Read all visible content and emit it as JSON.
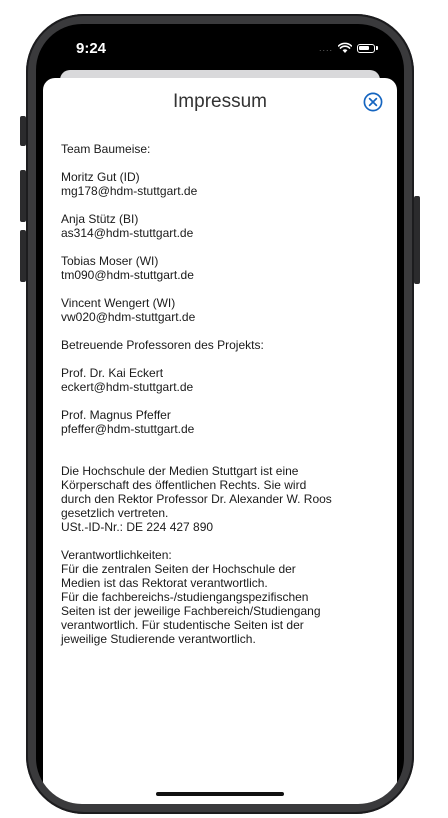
{
  "status_bar": {
    "time": "9:24",
    "signal": "....",
    "wifi_icon": "wifi-icon",
    "battery_icon": "battery-icon"
  },
  "modal": {
    "title": "Impressum",
    "close_icon": "close-circle-icon"
  },
  "content": {
    "team_heading": "Team Baumeise:",
    "members": [
      {
        "name": "Moritz Gut (ID)",
        "email": "mg178@hdm-stuttgart.de"
      },
      {
        "name": "Anja Stütz (BI)",
        "email": "as314@hdm-stuttgart.de"
      },
      {
        "name": "Tobias Moser (WI)",
        "email": "tm090@hdm-stuttgart.de"
      },
      {
        "name": "Vincent Wengert (WI)",
        "email": "vw020@hdm-stuttgart.de"
      }
    ],
    "professors_heading": "Betreuende Professoren des Projekts:",
    "professors": [
      {
        "name": "Prof. Dr. Kai Eckert",
        "email": "eckert@hdm-stuttgart.de"
      },
      {
        "name": "Prof. Magnus Pfeffer",
        "email": "pfeffer@hdm-stuttgart.de"
      }
    ],
    "legal_lines": [
      "Die Hochschule der Medien Stuttgart ist eine",
      "Körperschaft des öffentlichen Rechts. Sie wird",
      "durch den Rektor Professor Dr. Alexander W. Roos",
      "gesetzlich vertreten.",
      "USt.-ID-Nr.: DE 224 427 890"
    ],
    "responsibility_lines": [
      "Verantwortlichkeiten:",
      "Für die zentralen Seiten der Hochschule der",
      "Medien ist das Rektorat verantwortlich.",
      "Für die fachbereichs-/studiengangspezifischen",
      "Seiten ist der jeweilige Fachbereich/Studiengang",
      "verantwortlich. Für studentische Seiten ist der",
      "jeweilige Studierende verantwortlich."
    ]
  },
  "colors": {
    "accent": "#1565c0",
    "device_frame": "#3a3a3c"
  }
}
